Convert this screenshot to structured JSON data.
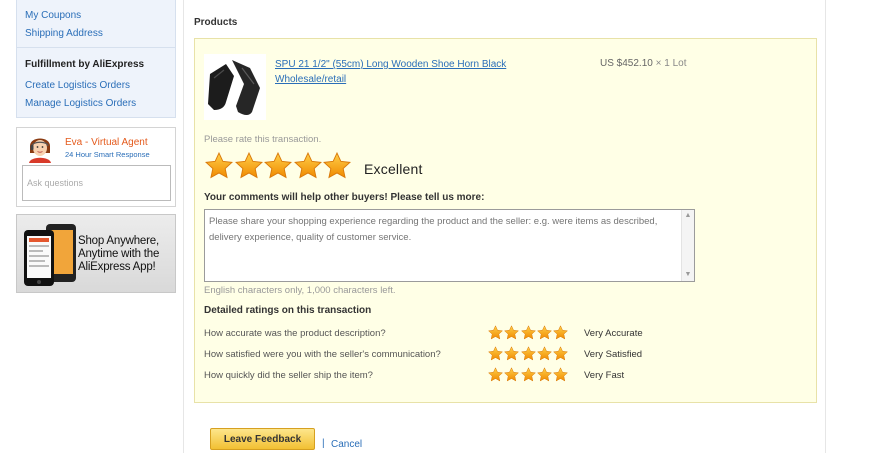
{
  "sidebar": {
    "links": [
      "My Coupons",
      "Shipping Address"
    ],
    "fulfillment_heading": "Fulfillment by AliExpress",
    "fulfillment_links": [
      "Create Logistics Orders",
      "Manage Logistics Orders"
    ]
  },
  "agent": {
    "name": "Eva - Virtual Agent",
    "subtitle": "24 Hour Smart Response",
    "input_placeholder": "Ask questions"
  },
  "app_promo": {
    "text": "Shop Anywhere, Anytime with the AliExpress App!"
  },
  "main": {
    "section_title": "Products",
    "product": {
      "title": "SPU 21 1/2\" (55cm) Long Wooden Shoe Horn Black Wholesale/retail",
      "price": "US $452.10",
      "quantity": "× 1 Lot"
    },
    "rate_prompt": "Please rate this transaction.",
    "overall_rating": {
      "stars": 5,
      "max": 5,
      "label": "Excellent"
    },
    "comments_label": "Your comments will help other buyers! Please tell us more:",
    "comment_placeholder": "Please share your shopping experience regarding the product and the seller: e.g. were items as described, delivery experience, quality of customer service.",
    "char_count": "English characters only, 1,000 characters left.",
    "detailed_title": "Detailed ratings on this transaction",
    "detailed_ratings": [
      {
        "question": "How accurate was the product description?",
        "stars": 5,
        "answer": "Very Accurate"
      },
      {
        "question": "How satisfied were you with the seller's communication?",
        "stars": 5,
        "answer": "Very Satisfied"
      },
      {
        "question": "How quickly did the seller ship the item?",
        "stars": 5,
        "answer": "Very Fast"
      }
    ]
  },
  "actions": {
    "submit_label": "Leave Feedback",
    "separator": "|",
    "cancel_label": "Cancel"
  },
  "colors": {
    "link": "#2a6eb8",
    "panel_bg": "#ffffe6",
    "star": "#f5a214",
    "agent_name": "#e45a1c",
    "button": "#f2c033"
  }
}
